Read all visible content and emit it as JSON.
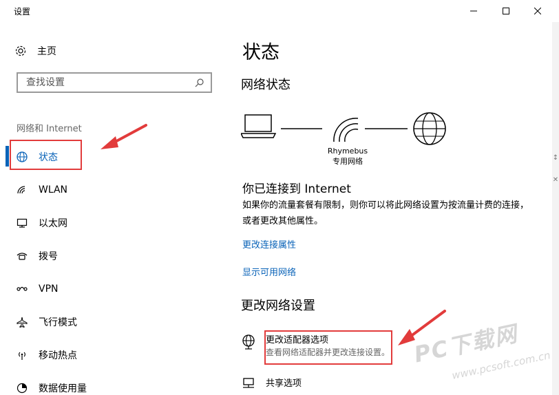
{
  "window": {
    "title": "设置"
  },
  "sidebar": {
    "home_label": "主页",
    "search_placeholder": "查找设置",
    "section_label": "网络和 Internet",
    "items": [
      {
        "label": "状态",
        "icon": "globe-icon",
        "active": true
      },
      {
        "label": "WLAN",
        "icon": "wifi-icon"
      },
      {
        "label": "以太网",
        "icon": "ethernet-icon"
      },
      {
        "label": "拨号",
        "icon": "dialup-icon"
      },
      {
        "label": "VPN",
        "icon": "vpn-icon"
      },
      {
        "label": "飞行模式",
        "icon": "airplane-icon"
      },
      {
        "label": "移动热点",
        "icon": "hotspot-icon"
      },
      {
        "label": "数据使用量",
        "icon": "data-usage-icon"
      }
    ]
  },
  "main": {
    "title": "状态",
    "network_status_heading": "网络状态",
    "network": {
      "name": "Rhymebus",
      "type": "专用网络"
    },
    "connected_title": "你已连接到 Internet",
    "connected_desc": "如果你的流量套餐有限制，则你可以将此网络设置为按流量计费的连接，或者更改其他属性。",
    "links": {
      "change_props": "更改连接属性",
      "show_networks": "显示可用网络"
    },
    "change_settings_heading": "更改网络设置",
    "adapter": {
      "title": "更改适配器选项",
      "desc": "查看网络适配器并更改连接设置。"
    },
    "sharing": {
      "title": "共享选项"
    }
  },
  "watermark": {
    "text": "PC下载网",
    "url": "www.pcsoft.com.cn"
  },
  "colors": {
    "accent": "#0a63b8",
    "annotation": "#e23b3b"
  }
}
